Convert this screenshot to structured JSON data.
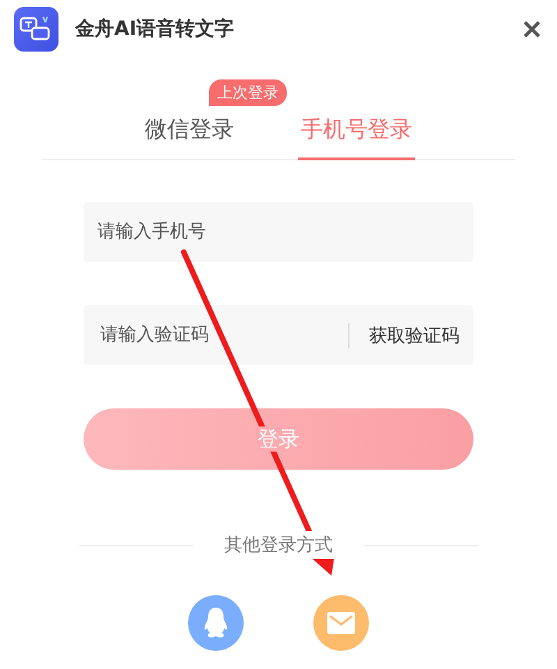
{
  "window": {
    "title": "金舟AI语音转文字"
  },
  "tabs": [
    {
      "label": "微信登录",
      "selected": false,
      "badge": "上次登录"
    },
    {
      "label": "手机号登录",
      "selected": true
    }
  ],
  "fields": [
    {
      "kind": "input",
      "placeholder": "请输入手机号"
    },
    {
      "kind": "code",
      "placeholder": "请输入验证码",
      "action": "获取验证码"
    }
  ],
  "login_button": "登录",
  "other_login": {
    "label": "其他登录方式",
    "methods": [
      {
        "kind": "qq",
        "color": "#7aaefc"
      },
      {
        "kind": "email",
        "color": "#fdbb6c"
      }
    ]
  }
}
